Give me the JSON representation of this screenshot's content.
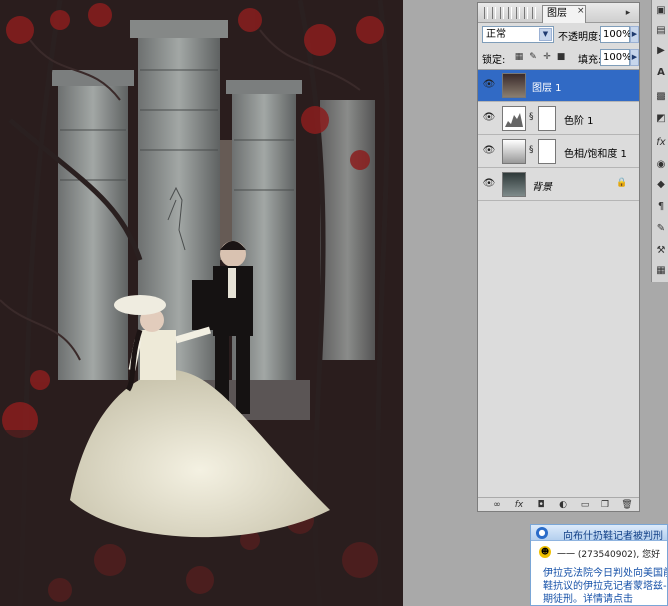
{
  "layers_panel": {
    "tab_label": "图层",
    "tab_close": "×",
    "menu_button": "▸",
    "blend_mode": "正常",
    "opacity_label": "不透明度:",
    "opacity_value": "100%",
    "lock_label": "锁定:",
    "fill_label": "填充:",
    "fill_value": "100%",
    "layers": [
      {
        "name": "图层 1",
        "selected": true
      },
      {
        "name": "色阶 1",
        "selected": false
      },
      {
        "name": "色相/饱和度 1",
        "selected": false
      },
      {
        "name": "背景",
        "selected": false
      }
    ]
  },
  "qq_popup": {
    "title": "向布什扔鞋记者被判刑",
    "user": "一一 (273540902), 您好",
    "body_lines": [
      "伊拉克法院今日判处向美国前",
      "鞋抗议的伊拉克记者蒙塔兹-",
      "期徒刑。详情请点击"
    ]
  },
  "colors": {
    "selection": "#316ac5",
    "panel_bg": "#dcdcdc",
    "qq_link": "#1651a8"
  }
}
